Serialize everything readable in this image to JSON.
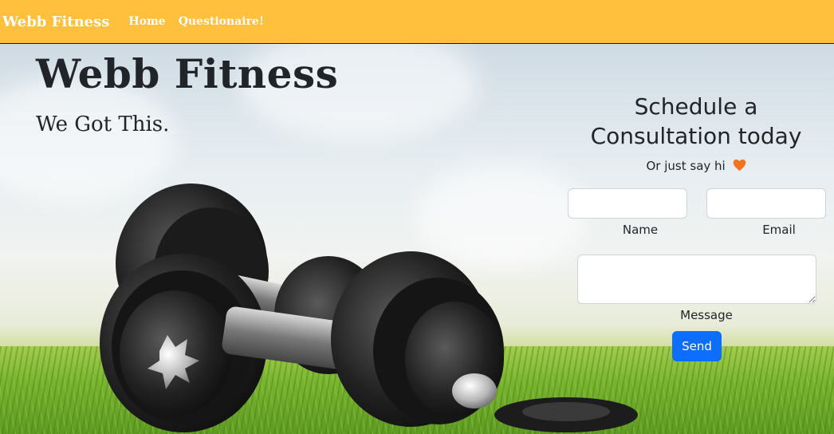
{
  "navbar": {
    "brand": "Webb Fitness",
    "links": [
      {
        "label": "Home"
      },
      {
        "label": "Questionaire!"
      }
    ],
    "color": "#ffc13d"
  },
  "hero": {
    "title": "Webb Fitness",
    "tagline": "We Got This."
  },
  "contact_form": {
    "title": "Schedule a Consultation today",
    "subtitle": "Or just say hi",
    "subtitle_icon": "orange-heart-icon",
    "name_label": "Name",
    "name_value": "",
    "email_label": "Email",
    "email_value": "",
    "message_label": "Message",
    "message_value": "",
    "send_label": "Send",
    "send_color": "#0d6efd"
  }
}
